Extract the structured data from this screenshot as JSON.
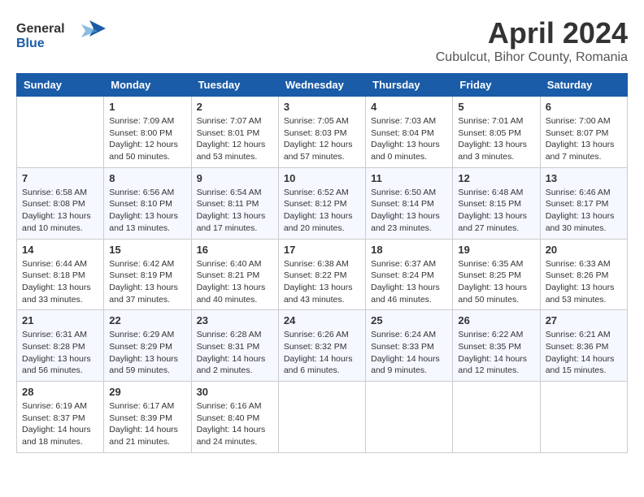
{
  "logo": {
    "text_general": "General",
    "text_blue": "Blue"
  },
  "title": {
    "month_year": "April 2024",
    "location": "Cubulcut, Bihor County, Romania"
  },
  "weekdays": [
    "Sunday",
    "Monday",
    "Tuesday",
    "Wednesday",
    "Thursday",
    "Friday",
    "Saturday"
  ],
  "weeks": [
    [
      {
        "day": "",
        "info": ""
      },
      {
        "day": "1",
        "info": "Sunrise: 7:09 AM\nSunset: 8:00 PM\nDaylight: 12 hours\nand 50 minutes."
      },
      {
        "day": "2",
        "info": "Sunrise: 7:07 AM\nSunset: 8:01 PM\nDaylight: 12 hours\nand 53 minutes."
      },
      {
        "day": "3",
        "info": "Sunrise: 7:05 AM\nSunset: 8:03 PM\nDaylight: 12 hours\nand 57 minutes."
      },
      {
        "day": "4",
        "info": "Sunrise: 7:03 AM\nSunset: 8:04 PM\nDaylight: 13 hours\nand 0 minutes."
      },
      {
        "day": "5",
        "info": "Sunrise: 7:01 AM\nSunset: 8:05 PM\nDaylight: 13 hours\nand 3 minutes."
      },
      {
        "day": "6",
        "info": "Sunrise: 7:00 AM\nSunset: 8:07 PM\nDaylight: 13 hours\nand 7 minutes."
      }
    ],
    [
      {
        "day": "7",
        "info": "Sunrise: 6:58 AM\nSunset: 8:08 PM\nDaylight: 13 hours\nand 10 minutes."
      },
      {
        "day": "8",
        "info": "Sunrise: 6:56 AM\nSunset: 8:10 PM\nDaylight: 13 hours\nand 13 minutes."
      },
      {
        "day": "9",
        "info": "Sunrise: 6:54 AM\nSunset: 8:11 PM\nDaylight: 13 hours\nand 17 minutes."
      },
      {
        "day": "10",
        "info": "Sunrise: 6:52 AM\nSunset: 8:12 PM\nDaylight: 13 hours\nand 20 minutes."
      },
      {
        "day": "11",
        "info": "Sunrise: 6:50 AM\nSunset: 8:14 PM\nDaylight: 13 hours\nand 23 minutes."
      },
      {
        "day": "12",
        "info": "Sunrise: 6:48 AM\nSunset: 8:15 PM\nDaylight: 13 hours\nand 27 minutes."
      },
      {
        "day": "13",
        "info": "Sunrise: 6:46 AM\nSunset: 8:17 PM\nDaylight: 13 hours\nand 30 minutes."
      }
    ],
    [
      {
        "day": "14",
        "info": "Sunrise: 6:44 AM\nSunset: 8:18 PM\nDaylight: 13 hours\nand 33 minutes."
      },
      {
        "day": "15",
        "info": "Sunrise: 6:42 AM\nSunset: 8:19 PM\nDaylight: 13 hours\nand 37 minutes."
      },
      {
        "day": "16",
        "info": "Sunrise: 6:40 AM\nSunset: 8:21 PM\nDaylight: 13 hours\nand 40 minutes."
      },
      {
        "day": "17",
        "info": "Sunrise: 6:38 AM\nSunset: 8:22 PM\nDaylight: 13 hours\nand 43 minutes."
      },
      {
        "day": "18",
        "info": "Sunrise: 6:37 AM\nSunset: 8:24 PM\nDaylight: 13 hours\nand 46 minutes."
      },
      {
        "day": "19",
        "info": "Sunrise: 6:35 AM\nSunset: 8:25 PM\nDaylight: 13 hours\nand 50 minutes."
      },
      {
        "day": "20",
        "info": "Sunrise: 6:33 AM\nSunset: 8:26 PM\nDaylight: 13 hours\nand 53 minutes."
      }
    ],
    [
      {
        "day": "21",
        "info": "Sunrise: 6:31 AM\nSunset: 8:28 PM\nDaylight: 13 hours\nand 56 minutes."
      },
      {
        "day": "22",
        "info": "Sunrise: 6:29 AM\nSunset: 8:29 PM\nDaylight: 13 hours\nand 59 minutes."
      },
      {
        "day": "23",
        "info": "Sunrise: 6:28 AM\nSunset: 8:31 PM\nDaylight: 14 hours\nand 2 minutes."
      },
      {
        "day": "24",
        "info": "Sunrise: 6:26 AM\nSunset: 8:32 PM\nDaylight: 14 hours\nand 6 minutes."
      },
      {
        "day": "25",
        "info": "Sunrise: 6:24 AM\nSunset: 8:33 PM\nDaylight: 14 hours\nand 9 minutes."
      },
      {
        "day": "26",
        "info": "Sunrise: 6:22 AM\nSunset: 8:35 PM\nDaylight: 14 hours\nand 12 minutes."
      },
      {
        "day": "27",
        "info": "Sunrise: 6:21 AM\nSunset: 8:36 PM\nDaylight: 14 hours\nand 15 minutes."
      }
    ],
    [
      {
        "day": "28",
        "info": "Sunrise: 6:19 AM\nSunset: 8:37 PM\nDaylight: 14 hours\nand 18 minutes."
      },
      {
        "day": "29",
        "info": "Sunrise: 6:17 AM\nSunset: 8:39 PM\nDaylight: 14 hours\nand 21 minutes."
      },
      {
        "day": "30",
        "info": "Sunrise: 6:16 AM\nSunset: 8:40 PM\nDaylight: 14 hours\nand 24 minutes."
      },
      {
        "day": "",
        "info": ""
      },
      {
        "day": "",
        "info": ""
      },
      {
        "day": "",
        "info": ""
      },
      {
        "day": "",
        "info": ""
      }
    ]
  ]
}
